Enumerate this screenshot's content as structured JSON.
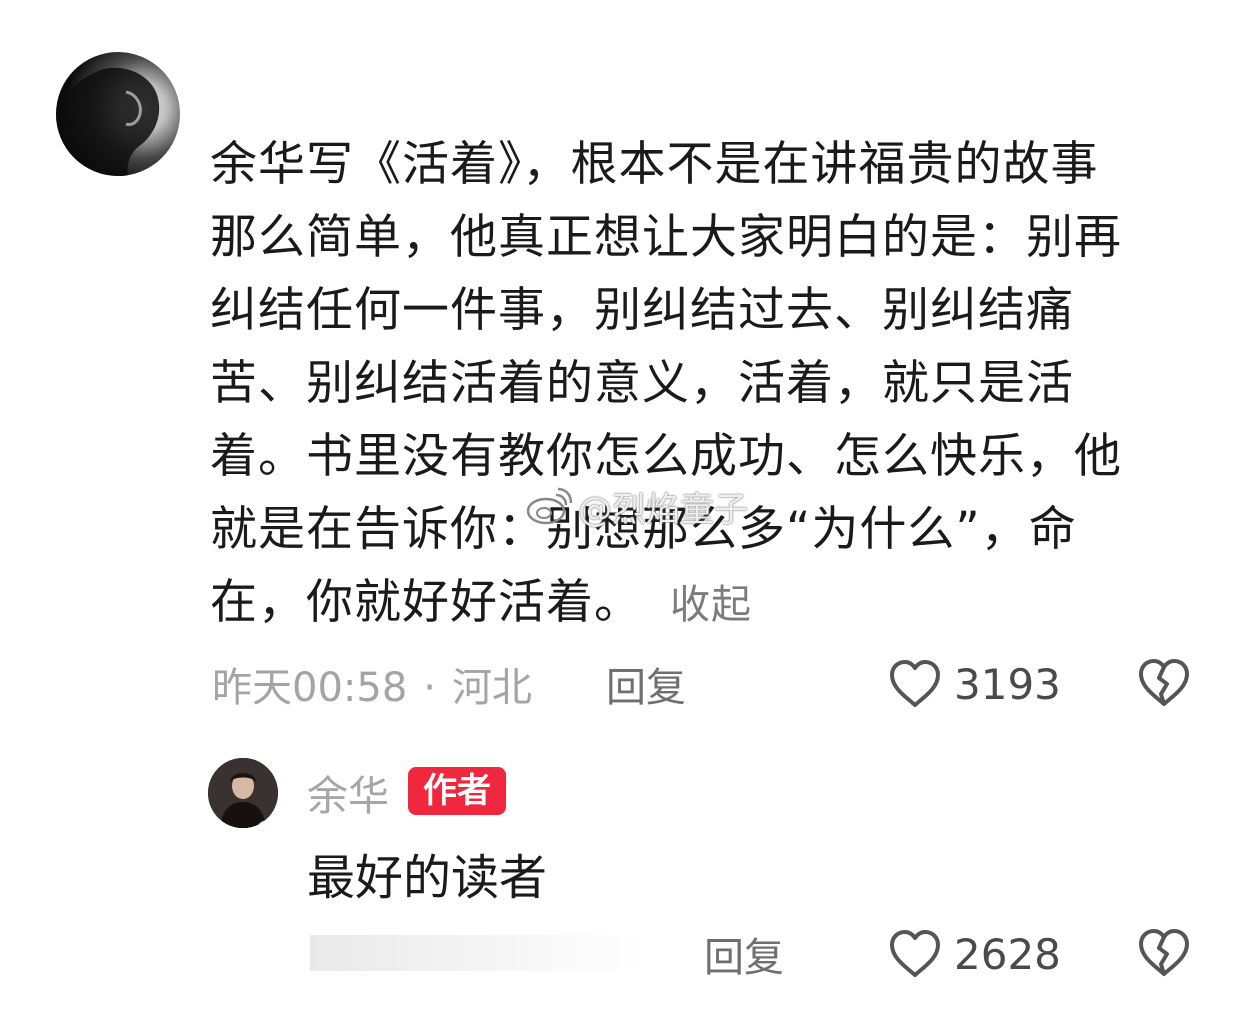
{
  "comment": {
    "lines": [
      "余华写《活着》，根本不是在讲福贵的故事",
      "那么简单，他真正想让大家明白的是：别再",
      "纠结任何一件事，别纠结过去、别纠结痛",
      "苦、别纠结活着的意义，活着，就只是活",
      "着。书里没有教你怎么成功、怎么快乐，他",
      "就是在告诉你：别想那么多“为什么”，命",
      "在，你就好好活着。"
    ],
    "collapse_label": "收起",
    "timestamp": "昨天00:58",
    "separator": "·",
    "location": "河北",
    "reply_label": "回复",
    "like_count": "3193"
  },
  "reply": {
    "author": "余华",
    "badge": "作者",
    "text": "最好的读者",
    "reply_label": "回复",
    "like_count": "2628"
  },
  "watermark": {
    "text": "@烈焰童子"
  },
  "colors": {
    "badge": "#f0283e",
    "meta": "#a4a4a4",
    "text": "#1a1a1a"
  }
}
